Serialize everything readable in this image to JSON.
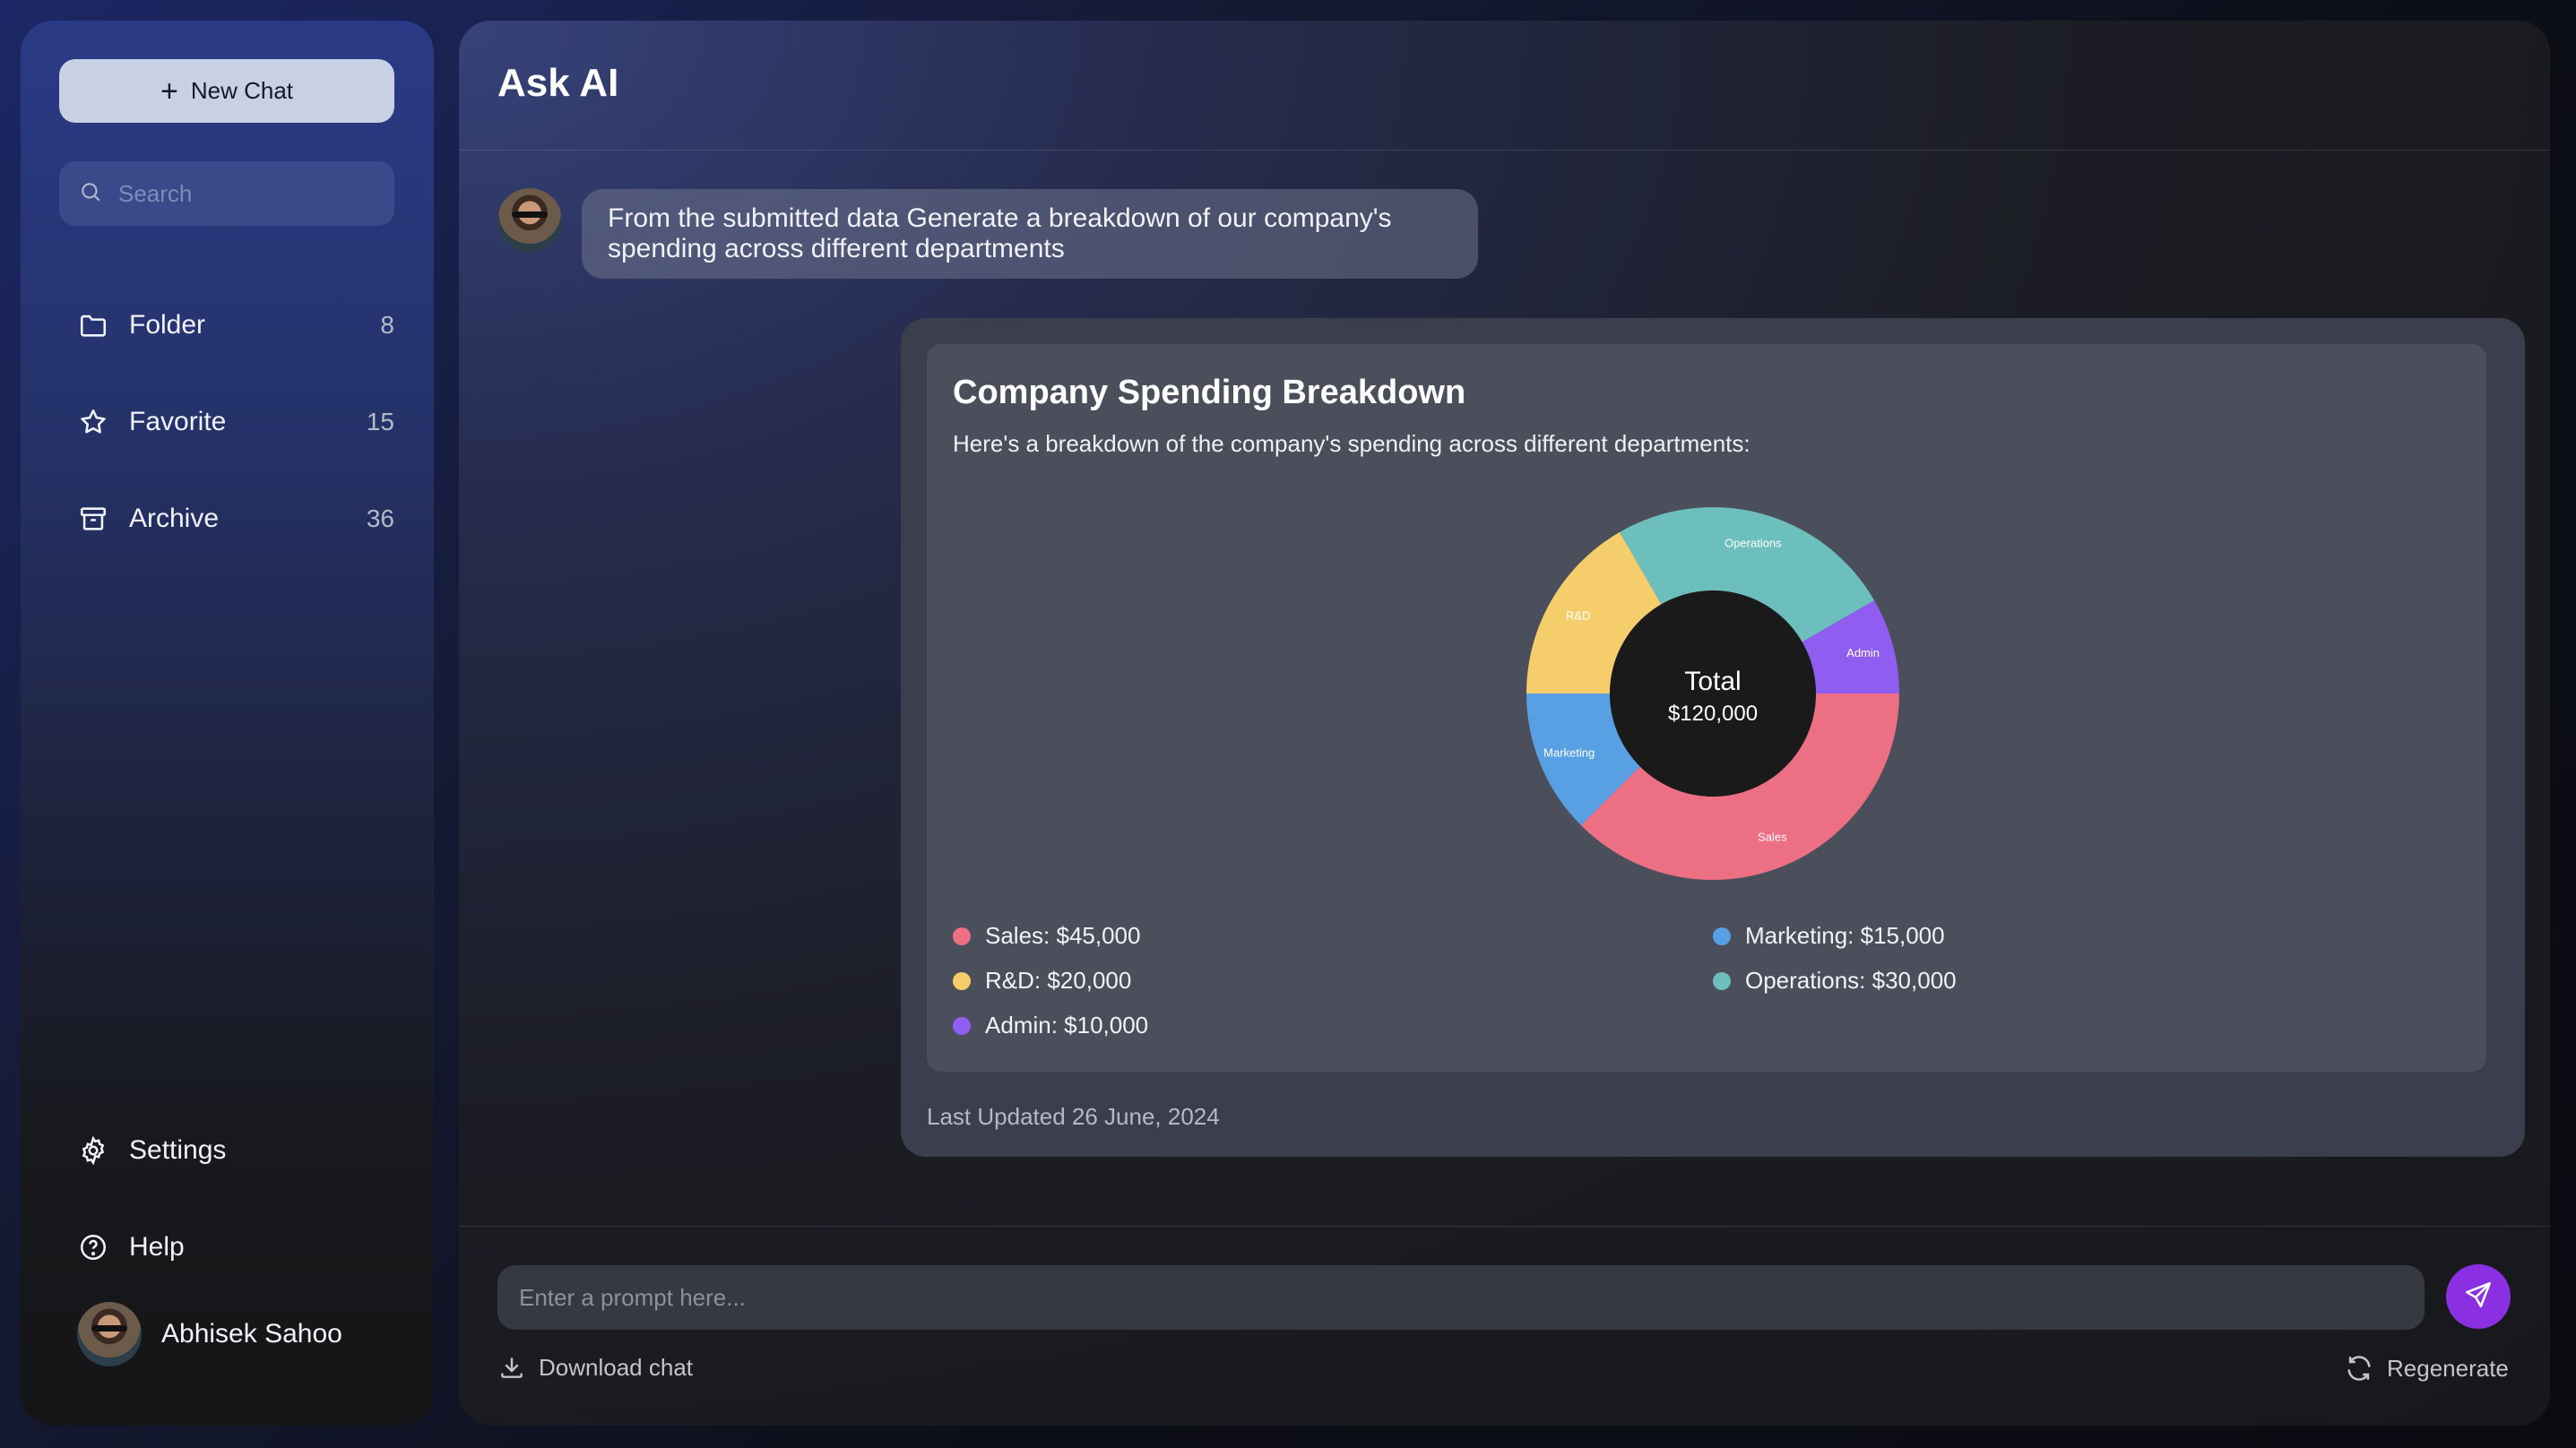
{
  "sidebar": {
    "new_chat_label": "New Chat",
    "search_placeholder": "Search",
    "items": [
      {
        "label": "Folder",
        "count": "8",
        "icon": "folder-icon"
      },
      {
        "label": "Favorite",
        "count": "15",
        "icon": "star-icon"
      },
      {
        "label": "Archive",
        "count": "36",
        "icon": "archive-icon"
      }
    ],
    "bottom": [
      {
        "label": "Settings",
        "icon": "gear-icon"
      },
      {
        "label": "Help",
        "icon": "help-icon"
      }
    ],
    "user_name": "Abhisek Sahoo"
  },
  "header": {
    "title": "Ask AI"
  },
  "conversation": {
    "user_message": "From the submitted data Generate a breakdown of our company's spending across different departments",
    "answer": {
      "title": "Company Spending Breakdown",
      "description": "Here's a breakdown of the company's spending across different departments:",
      "center_label": "Total",
      "center_value": "$120,000",
      "legend": [
        {
          "text": "Sales: $45,000",
          "color": "#ec6f84"
        },
        {
          "text": "R&D: $20,000",
          "color": "#f6cd6b"
        },
        {
          "text": "Admin: $10,000",
          "color": "#8f5df0"
        },
        {
          "text": "Marketing: $15,000",
          "color": "#58a0e3"
        },
        {
          "text": "Operations: $30,000",
          "color": "#6cbfbd"
        }
      ],
      "last_updated": "Last Updated 26 June, 2024"
    }
  },
  "chart_data": {
    "type": "pie",
    "title": "Company Spending Breakdown",
    "categories": [
      "Sales",
      "Marketing",
      "R&D",
      "Operations",
      "Admin"
    ],
    "values": [
      45000,
      15000,
      20000,
      30000,
      10000
    ],
    "colors": [
      "#ec6f84",
      "#58a0e3",
      "#f6cd6b",
      "#6cbfbd",
      "#8f5df0"
    ],
    "donut": true,
    "center_text": [
      "Total",
      "$120,000"
    ]
  },
  "composer": {
    "placeholder": "Enter a prompt here...",
    "download_label": "Download chat",
    "regenerate_label": "Regenerate",
    "send_color": "#8a2fe2"
  }
}
